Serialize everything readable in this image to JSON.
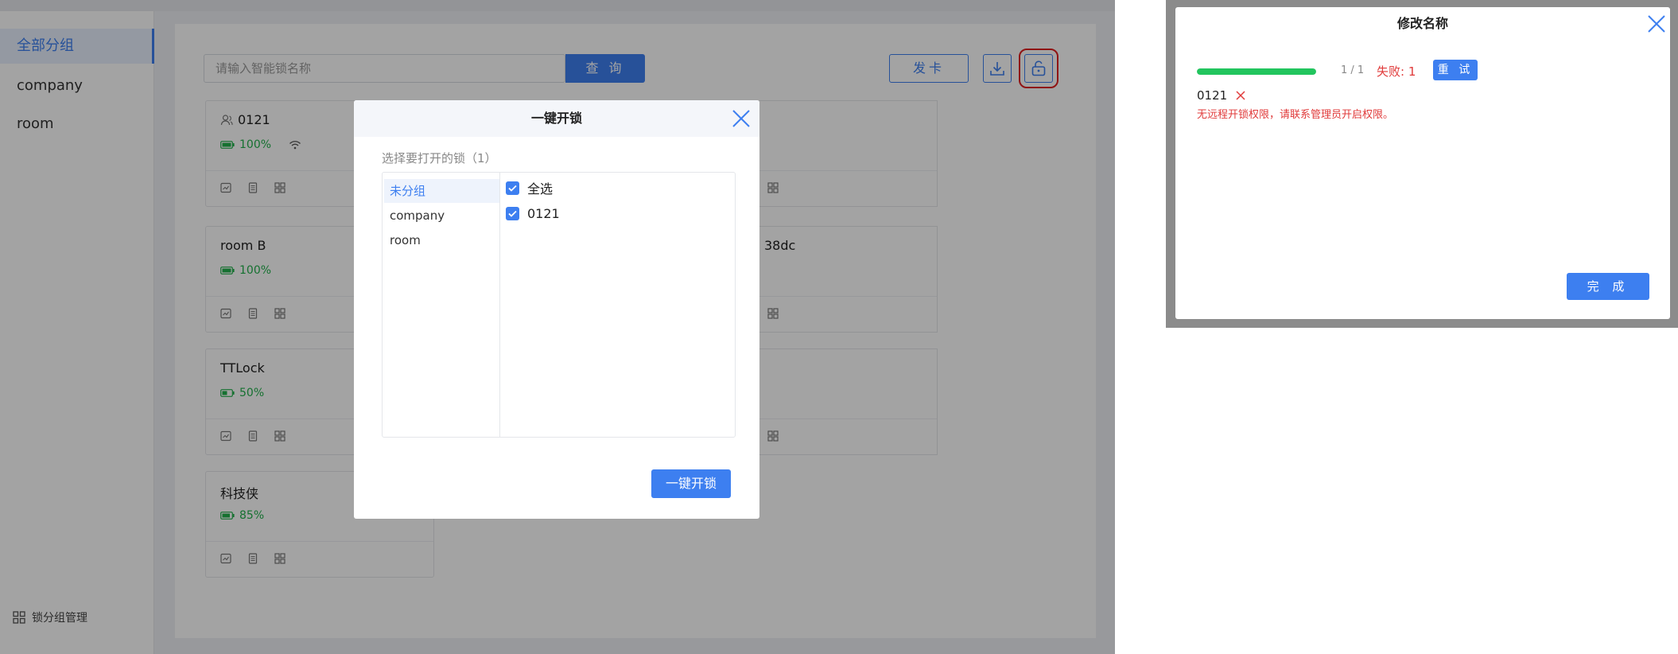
{
  "colors": {
    "accent": "#3d7ff0",
    "success": "#22b14c",
    "progress": "#22c55e",
    "danger": "#e03a3a",
    "highlight": "#e02020"
  },
  "sidebar": {
    "items": [
      {
        "label": "全部分组",
        "active": true
      },
      {
        "label": "company",
        "active": false
      },
      {
        "label": "room",
        "active": false
      }
    ],
    "manage_label": "锁分组管理",
    "manage_icon": "grid-icon"
  },
  "toolbar": {
    "search_placeholder": "请输入智能锁名称",
    "query_label": "查 询",
    "issue_card_label": "发卡",
    "download_icon": "download-icon",
    "unlock_icon": "unlock-icon"
  },
  "locks": [
    {
      "name": "0121",
      "battery": "100%",
      "has_user_icon": true,
      "has_wifi": true
    },
    {
      "name": "room B",
      "battery": "100%",
      "has_user_icon": false,
      "has_wifi": false
    },
    {
      "name": "TTLock",
      "battery": "50%",
      "has_user_icon": false,
      "has_wifi": false
    },
    {
      "name": "科技侠",
      "battery": "85%",
      "has_user_icon": false,
      "has_wifi": false
    }
  ],
  "partial_lock_text": "38dc",
  "unlock_modal": {
    "title": "一键开锁",
    "select_label": "选择要打开的锁（1）",
    "groups": [
      {
        "label": "未分组",
        "active": true
      },
      {
        "label": "company",
        "active": false
      },
      {
        "label": "room",
        "active": false
      }
    ],
    "select_all_label": "全选",
    "options": [
      {
        "label": "0121",
        "checked": true
      }
    ],
    "confirm_label": "一键开锁"
  },
  "result_dialog": {
    "title": "修改名称",
    "progress": {
      "done": 1,
      "total": 1,
      "text": "1 / 1"
    },
    "fail_text": "失败: 1",
    "retry_label": "重 试",
    "result_name": "0121",
    "error_message": "无远程开锁权限，请联系管理员开启权限。",
    "done_label": "完 成"
  }
}
